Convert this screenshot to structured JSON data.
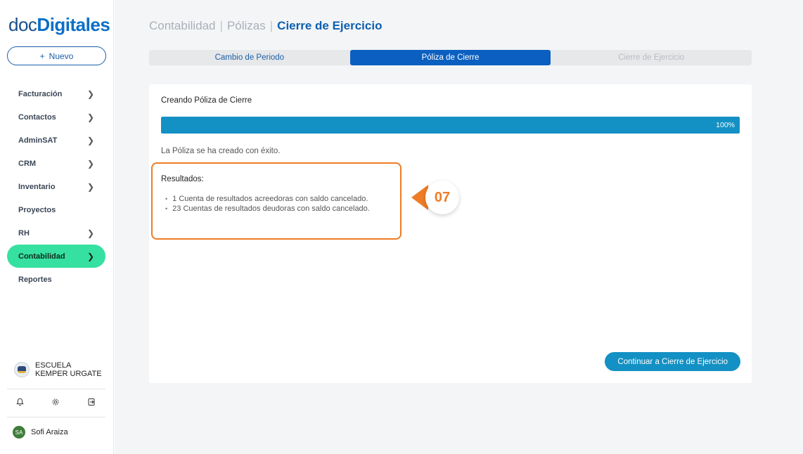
{
  "sidebar": {
    "logo": {
      "part1": "doc",
      "part2": "Digitales"
    },
    "new_button": {
      "icon": "+",
      "label": "Nuevo"
    },
    "nav": [
      {
        "label": "Facturación",
        "chevron": true
      },
      {
        "label": "Contactos",
        "chevron": true
      },
      {
        "label": "AdminSAT",
        "chevron": true
      },
      {
        "label": "CRM",
        "chevron": true
      },
      {
        "label": "Inventario",
        "chevron": true
      },
      {
        "label": "Proyectos",
        "chevron": false
      },
      {
        "label": "RH",
        "chevron": true
      },
      {
        "label": "Contabilidad",
        "chevron": true,
        "active": true
      },
      {
        "label": "Reportes",
        "chevron": false
      }
    ],
    "organization": "ESCUELA KEMPER URGATE",
    "footer_icons": [
      "bell-icon",
      "gear-icon",
      "logout-icon"
    ],
    "user": {
      "initials": "SA",
      "name": "Sofi Araiza"
    }
  },
  "header": {
    "breadcrumb": [
      "Contabilidad",
      "Pólizas"
    ],
    "current": "Cierre de Ejercicio"
  },
  "steps": [
    {
      "label": "Cambio de Periodo",
      "state": "done"
    },
    {
      "label": "Póliza de Cierre",
      "state": "active"
    },
    {
      "label": "Cierre de Ejercicio",
      "state": "disabled"
    }
  ],
  "card": {
    "title": "Creando Póliza de Cierre",
    "progress_percent": 100,
    "progress_label": "100%",
    "success_message": "La Póliza se ha creado con éxito.",
    "results_title": "Resultados:",
    "results": [
      "1 Cuenta de resultados acreedoras con saldo cancelado.",
      "23 Cuentas de resultados deudoras con saldo cancelado."
    ],
    "continue_button": "Continuar a Cierre de Ejercicio"
  },
  "annotation": {
    "number": "07"
  },
  "colors": {
    "accent_orange": "#ee7c25",
    "primary_blue": "#0b5fc0",
    "progress_blue": "#1390c4",
    "active_nav_green": "#36e0a0"
  }
}
